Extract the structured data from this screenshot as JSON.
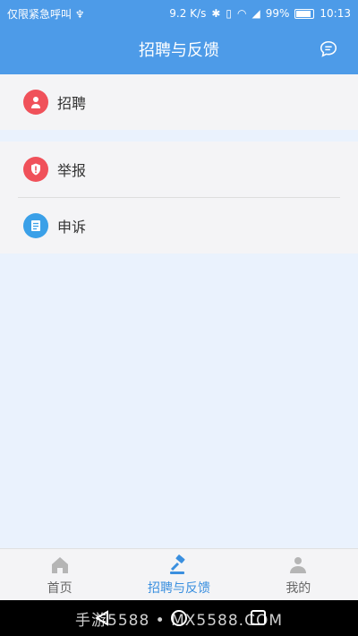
{
  "status": {
    "left": "仅限紧急呼叫 ♆",
    "speed": "9.2 K/s",
    "battery": "99%",
    "time": "10:13"
  },
  "header": {
    "title": "招聘与反馈",
    "chat_icon": "chat-bubble-icon"
  },
  "menu": [
    {
      "label": "招聘",
      "icon": "recruit-person-icon",
      "color": "#f0515a"
    },
    {
      "label": "举报",
      "icon": "report-shield-icon",
      "color": "#f0515a"
    },
    {
      "label": "申诉",
      "icon": "appeal-document-icon",
      "color": "#3aa0e8"
    }
  ],
  "tabbar": {
    "tabs": [
      {
        "label": "首页",
        "icon": "home-icon"
      },
      {
        "label": "招聘与反馈",
        "icon": "gavel-icon"
      },
      {
        "label": "我的",
        "icon": "profile-icon"
      }
    ]
  },
  "watermark": "手游5588 • MX5588.COM",
  "colors": {
    "primary": "#4d9be8",
    "active_tab": "#3a8fdf",
    "background": "#eaf2fd"
  }
}
